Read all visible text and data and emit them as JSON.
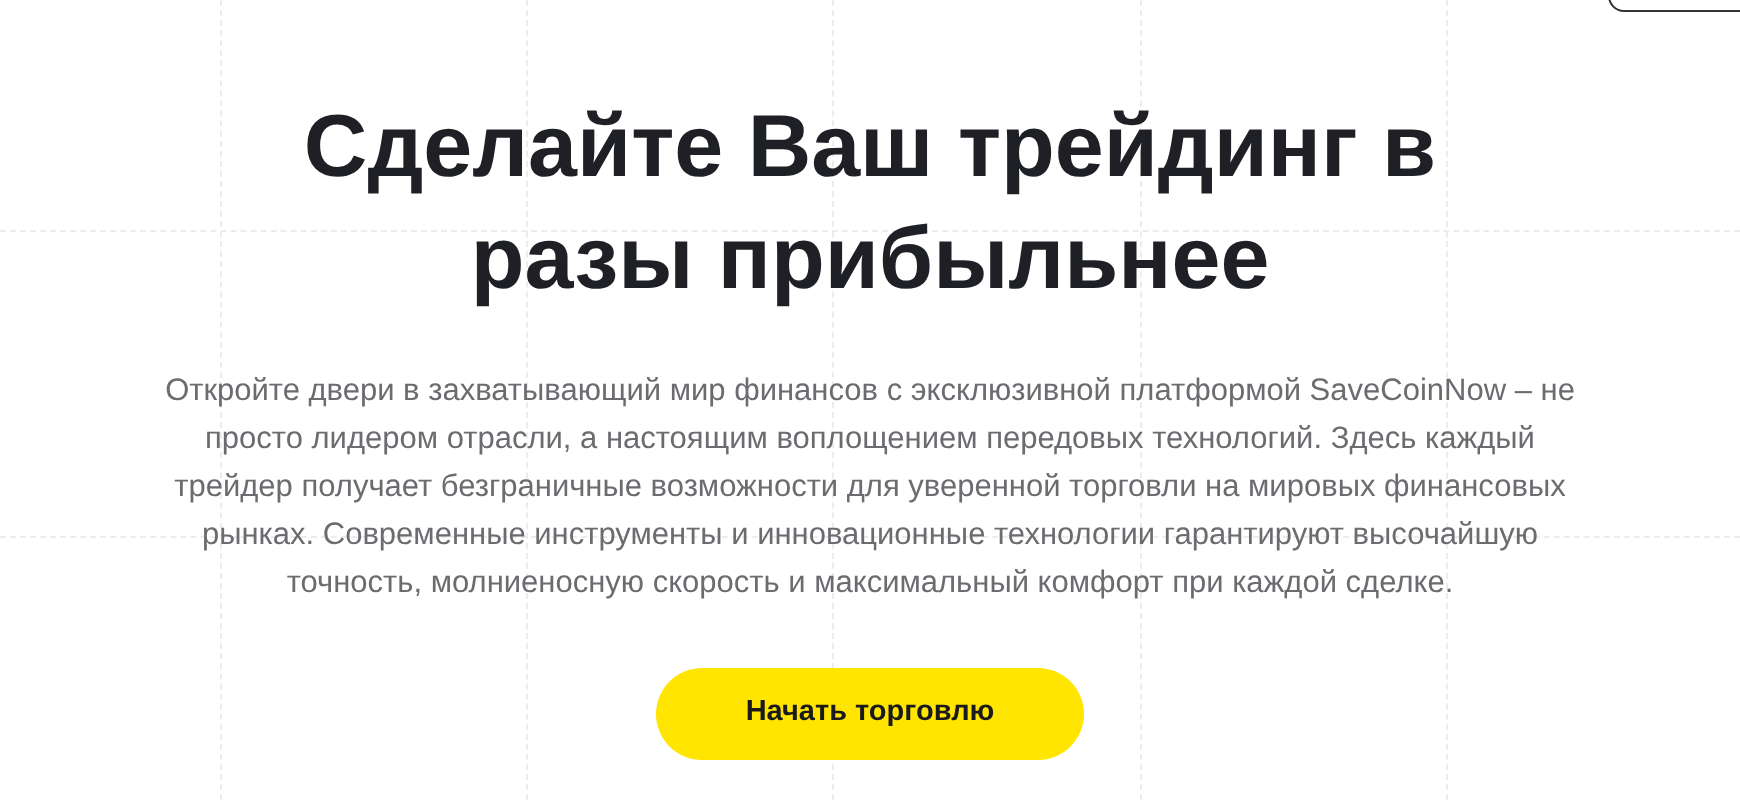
{
  "hero": {
    "title": "Сделайте Ваш трейдинг в разы прибыльнее",
    "description": "Откройте двери в захватывающий мир финансов с эксклюзивной платформой SaveCoinNow – не просто лидером отрасли, а настоящим воплощением передовых технологий. Здесь каждый трейдер получает безграничные возможности для уверенной торговли на мировых финансовых рынках. Современные инструменты и инновационные технологии гарантируют высочайшую точность, молниеносную скорость и максимальный комфорт при каждой сделке.",
    "cta_button": "Начать торговлю"
  }
}
